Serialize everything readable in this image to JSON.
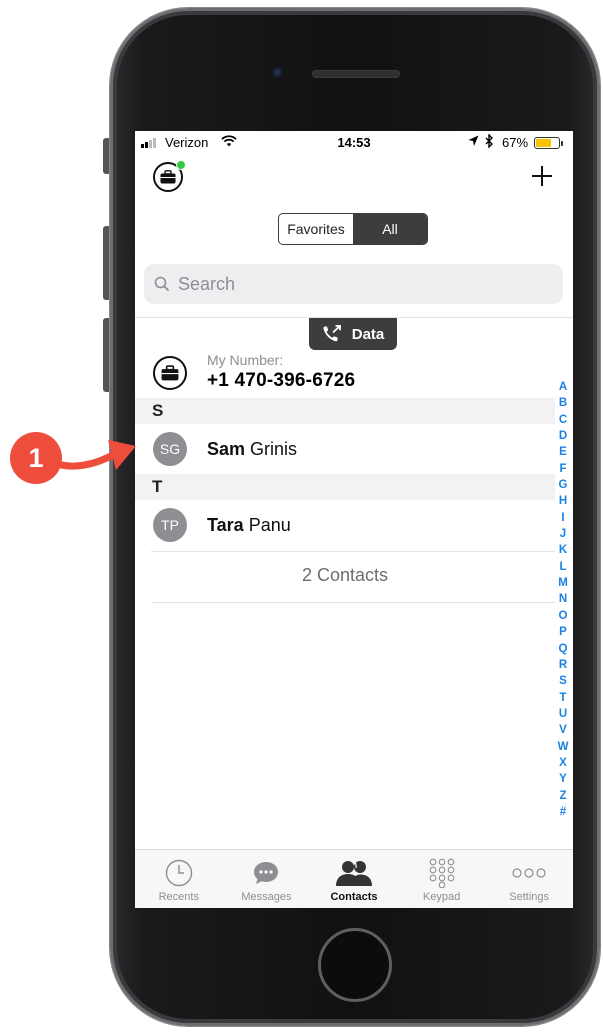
{
  "status_bar": {
    "carrier": "Verizon",
    "time": "14:53",
    "battery": "67%",
    "battery_level": 0.67,
    "battery_color": "#f5c400"
  },
  "nav": {
    "left_icon": "briefcase-icon",
    "right_icon": "plus-icon",
    "presence_color": "#2ecc40"
  },
  "segmented": {
    "options": [
      "Favorites",
      "All"
    ],
    "selected": "All"
  },
  "search": {
    "placeholder": "Search",
    "icon": "magnifier-icon"
  },
  "data_pill": {
    "label": "Data",
    "icon": "phone-forward-icon"
  },
  "my_number": {
    "label": "My Number:",
    "value": "+1 470-396-6726"
  },
  "sections": [
    {
      "letter": "S",
      "contacts": [
        {
          "initials": "SG",
          "first": "Sam",
          "last": "Grinis"
        }
      ]
    },
    {
      "letter": "T",
      "contacts": [
        {
          "initials": "TP",
          "first": "Tara",
          "last": "Panu"
        }
      ]
    }
  ],
  "contacts_count": "2 Contacts",
  "alphabet_index": [
    "A",
    "B",
    "C",
    "D",
    "E",
    "F",
    "G",
    "H",
    "I",
    "J",
    "K",
    "L",
    "M",
    "N",
    "O",
    "P",
    "Q",
    "R",
    "S",
    "T",
    "U",
    "V",
    "W",
    "X",
    "Y",
    "Z",
    "#"
  ],
  "tab_bar": {
    "tabs": [
      {
        "label": "Recents",
        "icon": "clock-icon"
      },
      {
        "label": "Messages",
        "icon": "chat-bubble-icon"
      },
      {
        "label": "Contacts",
        "icon": "people-icon"
      },
      {
        "label": "Keypad",
        "icon": "keypad-icon"
      },
      {
        "label": "Settings",
        "icon": "more-dots-icon"
      }
    ],
    "active": "Contacts"
  },
  "annotation": {
    "step_number": "1",
    "color": "#ee4d3c"
  }
}
